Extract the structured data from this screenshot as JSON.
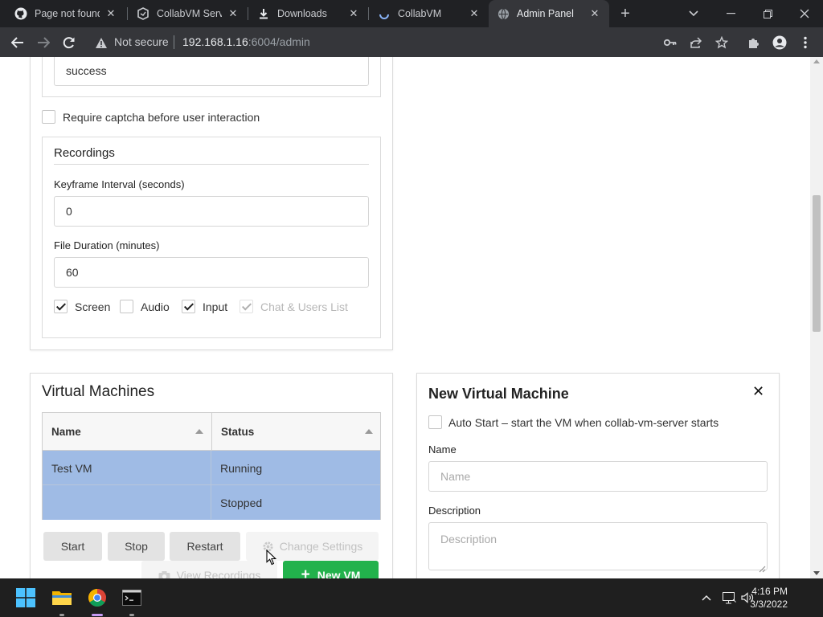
{
  "browser": {
    "tabs": [
      {
        "title": "Page not found",
        "icon": "github-icon",
        "active": false
      },
      {
        "title": "CollabVM Serve",
        "icon": "collabvm-server-icon",
        "active": false
      },
      {
        "title": "Downloads",
        "icon": "download-icon",
        "active": false
      },
      {
        "title": "CollabVM",
        "icon": "loading-spinner-icon",
        "active": false
      },
      {
        "title": "Admin Panel",
        "icon": "globe-icon",
        "active": true
      }
    ],
    "security_label": "Not secure",
    "url_host": "192.168.1.16",
    "url_rest": ":6004/admin"
  },
  "settings": {
    "top_input_value": "success",
    "require_captcha_label": "Require captcha before user interaction",
    "require_captcha_checked": false,
    "recordings": {
      "title": "Recordings",
      "keyframe_label": "Keyframe Interval (seconds)",
      "keyframe_value": "0",
      "duration_label": "File Duration (minutes)",
      "duration_value": "60",
      "options": [
        {
          "label": "Screen",
          "checked": true,
          "disabled": false
        },
        {
          "label": "Audio",
          "checked": false,
          "disabled": false
        },
        {
          "label": "Input",
          "checked": true,
          "disabled": false
        },
        {
          "label": "Chat & Users List",
          "checked": true,
          "disabled": true
        }
      ]
    }
  },
  "vms": {
    "title": "Virtual Machines",
    "columns": [
      "Name",
      "Status"
    ],
    "rows": [
      {
        "name": "Test VM",
        "status": "Running"
      },
      {
        "name": "",
        "status": "Stopped"
      }
    ],
    "buttons": {
      "start": "Start",
      "stop": "Stop",
      "restart": "Restart",
      "change_settings": "Change Settings",
      "view_recordings": "View Recordings",
      "new_vm": "New VM"
    }
  },
  "new_vm": {
    "title": "New Virtual Machine",
    "auto_start_label": "Auto Start – start the VM when collab-vm-server starts",
    "auto_start_checked": false,
    "name_label": "Name",
    "name_placeholder": "Name",
    "description_label": "Description",
    "description_placeholder": "Description"
  },
  "taskbar": {
    "time": "4:16 PM",
    "date": "3/3/2022"
  },
  "colors": {
    "selected_row": "#9fbbe5",
    "green_button": "#22b24c"
  }
}
